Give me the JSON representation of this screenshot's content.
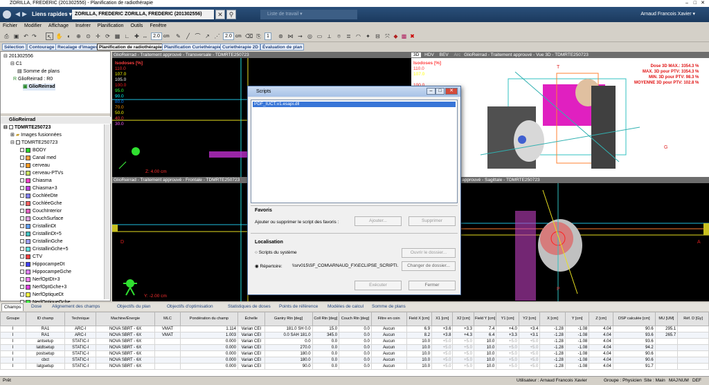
{
  "window_title": "ZORILLA, FREDERIC (201302556) - Planification de radiothérapie",
  "nav": {
    "quick_links": "Liens rapides",
    "patient": "ZORILLA, FREDERIC  ZORILLA, FREDERIC    (201302556)",
    "worklist": "Liste de travail",
    "user": "Arnaud Francois Xavier"
  },
  "menu": [
    "Fichier",
    "Modifier",
    "Affichage",
    "Insérer",
    "Planification",
    "Outils",
    "Fenêtre"
  ],
  "toolbar": {
    "zoom1": "2.0",
    "unit1": "cm",
    "zoom2": "2.0",
    "unit2": "cm",
    "count": "1"
  },
  "workspaces": [
    "Sélection",
    "Contourage",
    "Recalage d'images",
    "Planification de radiothérapie",
    "Planification Curiethérapie",
    "Curiethérapie 2D",
    "Évaluation de plan"
  ],
  "tree_top": [
    "201302556",
    "C1",
    "Somme de plans",
    "GlioReirrad : R0",
    "GlioReirrad"
  ],
  "structures_header": "GlioReirrad",
  "structures_plan": "TDMRTE250723",
  "fusion": "Images fusionnées",
  "structures_set": "TDMRTE250723",
  "structures": [
    {
      "name": "BODY",
      "color": "#2ad32a"
    },
    {
      "name": "Canal med",
      "color": "#ffa040"
    },
    {
      "name": "cerveau",
      "color": "#ff9a20"
    },
    {
      "name": "cerveau-PTVs",
      "color": "#c8e060"
    },
    {
      "name": "Chiasma",
      "color": "#ff40c8"
    },
    {
      "name": "Chiasma+3",
      "color": "#c040e0"
    },
    {
      "name": "CochléeDte",
      "color": "#8080ff"
    },
    {
      "name": "CochléeGche",
      "color": "#ff6060"
    },
    {
      "name": "CouchInterior",
      "color": "#e060c0"
    },
    {
      "name": "CouchSurface",
      "color": "#e0a0e0"
    },
    {
      "name": "CristallinDt",
      "color": "#60a0ff"
    },
    {
      "name": "CristallinDt+5",
      "color": "#40c0c0"
    },
    {
      "name": "CristallinGche",
      "color": "#a0a0ff"
    },
    {
      "name": "CristallinGche+5",
      "color": "#60e0e0"
    },
    {
      "name": "CTV",
      "color": "#ff4040"
    },
    {
      "name": "HippocampeDt",
      "color": "#4040ff"
    },
    {
      "name": "HippocampeGche",
      "color": "#e080ff"
    },
    {
      "name": "NerfOptDt+3",
      "color": "#ff80ff"
    },
    {
      "name": "NerfOptGche+3",
      "color": "#e040e0"
    },
    {
      "name": "NerfOptiqueDt",
      "color": "#ffff40"
    },
    {
      "name": "NerfOptiqueGche",
      "color": "#40ff40"
    }
  ],
  "views": {
    "transverse": "GlioReirrad - Traitement approuvé - Transversale - TDMRTE250723",
    "frontal": "GlioReirrad - Traitement approuvé - Frontale - TDMRTE250723",
    "sagittal": "GlioReirrad - Traitement approuvé - Sagittale - TDMRTE250723",
    "view3d": "GlioReirrad - Traitement approuvé - Vue 3D - TDMRTE250723",
    "tabs3d": [
      "3D",
      "HDV",
      "BEV",
      "Arc"
    ]
  },
  "isodoses": {
    "title": "Isodoses [%]",
    "levels": [
      {
        "v": "110.0",
        "c": "#ff3030"
      },
      {
        "v": "107.0",
        "c": "#ffff00"
      },
      {
        "v": "105.0",
        "c": "#ffffff"
      },
      {
        "v": "100.0",
        "c": "#ff2020"
      },
      {
        "v": "95.0",
        "c": "#30ff30"
      },
      {
        "v": "90.0",
        "c": "#00ffff"
      },
      {
        "v": "80.0",
        "c": "#0080ff"
      },
      {
        "v": "70.0",
        "c": "#ff9900"
      },
      {
        "v": "50.0",
        "c": "#ffff00"
      },
      {
        "v": "40.0",
        "c": "#ff4040"
      },
      {
        "v": "30.0",
        "c": "#ff60ff"
      }
    ]
  },
  "view_labels": {
    "z": "Z: 4.00 cm",
    "y": "Y: -2.00 cm",
    "d": "D",
    "a": "A",
    "g": "G",
    "t": "T",
    "p": "P"
  },
  "dose_info": [
    "Dose 3D MAX.: 3354.3 %",
    "MAX. 3D pour PTV: 3354.3 %",
    "MIN. 3D pour PTV: 98.3 %",
    "MOYENNE 3D pour PTV: 102.8 %"
  ],
  "dialog": {
    "title": "Scripts",
    "list_item": "PDF_IUCT.v1.esapi.dll",
    "fav_title": "Favoris",
    "fav_text": "Ajouter ou supprimer le script des favoris :",
    "add_btn": "Ajouter...",
    "remove_btn": "Supprimer",
    "loc_title": "Localisation",
    "sys_scripts": "Scripts du système",
    "open_btn": "Ouvrir le dossier...",
    "repo": "Répertoire:",
    "repo_path": "\\\\srv015\\SF_COM\\ARNAUD_FX\\ECLIPSE_SCRIPTI...",
    "change_btn": "Changer de dossier...",
    "run_btn": "Exécuter",
    "close_btn": "Fermer"
  },
  "bottom_tabs": [
    "Champs",
    "Dose",
    "Alignement des champs",
    "Objectifs du plan",
    "Objectifs d'optimisation",
    "Statistiques de doses",
    "Points de référence",
    "Modèles de calcul",
    "Somme de plans"
  ],
  "table": {
    "headers": [
      "Groupe",
      "ID champ",
      "Technique",
      "Machine/Énergie",
      "MLC",
      "Pondération du champ",
      "Échelle",
      "Gantry Rtn [deg]",
      "Coll Rtn [deg]",
      "Couch Rtn [deg]",
      "Filtre en coin",
      "Field X [cm]",
      "X1 [cm]",
      "X2 [cm]",
      "Field Y [cm]",
      "Y1 [cm]",
      "Y2 [cm]",
      "X [cm]",
      "Y [cm]",
      "Z [cm]",
      "DSP calculée [cm]",
      "MU [UM]",
      "Réf. D [Gy]"
    ],
    "rows": [
      [
        "I",
        "RA1",
        "ARC-I",
        "NOVA SBRT - 6X",
        "VMAT",
        "1.114",
        "Varian CEI",
        "181.0 SH 0.0",
        "15.0",
        "0.0",
        "Aucun",
        "6.9",
        "+3.6",
        "+3.3",
        "7.4",
        "+4.0",
        "+3.4",
        "-1.28",
        "-1.08",
        "4.04",
        "90.6",
        "295.1",
        ""
      ],
      [
        "I",
        "RA1",
        "ARC-I",
        "NOVA SBRT - 6X",
        "VMAT",
        "1.003",
        "Varian CEI",
        "0.0 SAH 181.0",
        "345.0",
        "0.0",
        "Aucun",
        "8.2",
        "+3.8",
        "+4.3",
        "6.4",
        "+3.3",
        "+3.1",
        "-1.28",
        "-1.08",
        "4.04",
        "93.6",
        "265.7",
        ""
      ],
      [
        "I",
        "antsetup",
        "STATIC-I",
        "NOVA SBRT - 6X",
        "",
        "0.000",
        "Varian CEI",
        "0.0",
        "0.0",
        "0.0",
        "Aucun",
        "10.0",
        "+5.0",
        "+5.0",
        "10.0",
        "+5.0",
        "+5.0",
        "-1.28",
        "-1.08",
        "4.04",
        "93.6",
        "",
        ""
      ],
      [
        "I",
        "latdtsetup",
        "STATIC-I",
        "NOVA SBRT - 6X",
        "",
        "0.000",
        "Varian CEI",
        "270.0",
        "0.0",
        "0.0",
        "Aucun",
        "10.0",
        "+5.0",
        "+5.0",
        "10.0",
        "+5.0",
        "+5.0",
        "-1.28",
        "-1.08",
        "4.04",
        "94.2",
        "",
        ""
      ],
      [
        "I",
        "postsetup",
        "STATIC-I",
        "NOVA SBRT - 6X",
        "",
        "0.000",
        "Varian CEI",
        "180.0",
        "0.0",
        "0.0",
        "Aucun",
        "10.0",
        "+5.0",
        "+5.0",
        "10.0",
        "+5.0",
        "+5.0",
        "-1.28",
        "-1.08",
        "4.04",
        "90.6",
        "",
        ""
      ],
      [
        "I",
        "cbct",
        "STATIC-I",
        "NOVA SBRT - 6X",
        "",
        "0.000",
        "Varian CEI",
        "180.0",
        "0.0",
        "0.0",
        "Aucun",
        "10.0",
        "+5.0",
        "+5.0",
        "10.0",
        "+5.0",
        "+5.0",
        "-1.28",
        "-1.08",
        "4.04",
        "90.6",
        "",
        ""
      ],
      [
        "I",
        "latgsetup",
        "STATIC-I",
        "NOVA SBRT - 6X",
        "",
        "0.000",
        "Varian CEI",
        "90.0",
        "0.0",
        "0.0",
        "Aucun",
        "10.0",
        "+5.0",
        "+5.0",
        "10.0",
        "+5.0",
        "+5.0",
        "-1.28",
        "-1.08",
        "4.04",
        "91.7",
        "",
        ""
      ]
    ]
  },
  "status": {
    "left": "Prêt",
    "user": "Utilisateur : Arnaud Francois Xavier",
    "group": "Groupe : Physicien",
    "site": "Site : Main",
    "maj": "MAJ",
    "num": "NUM",
    "def": "DEF"
  }
}
